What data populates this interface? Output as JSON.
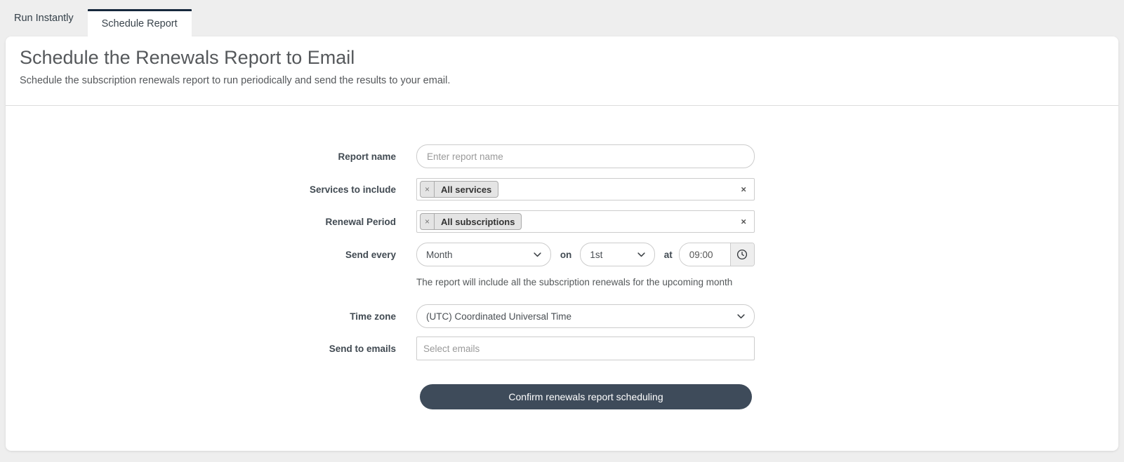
{
  "tabs": [
    {
      "label": "Run Instantly",
      "active": false
    },
    {
      "label": "Schedule Report",
      "active": true
    }
  ],
  "header": {
    "title": "Schedule the Renewals Report to Email",
    "subtitle": "Schedule the subscription renewals report to run periodically and send the results to your email."
  },
  "form": {
    "report_name": {
      "label": "Report name",
      "placeholder": "Enter report name",
      "value": ""
    },
    "services": {
      "label": "Services to include",
      "selected": [
        "All services"
      ]
    },
    "renewal_period": {
      "label": "Renewal Period",
      "selected": [
        "All subscriptions"
      ]
    },
    "send_every": {
      "label": "Send every",
      "frequency": "Month",
      "on_label": "on",
      "day": "1st",
      "at_label": "at",
      "time": "09:00"
    },
    "helper_text": "The report will include all the subscription renewals for the upcoming month",
    "time_zone": {
      "label": "Time zone",
      "value": "(UTC) Coordinated Universal Time"
    },
    "send_to_emails": {
      "label": "Send to emails",
      "placeholder": "Select emails"
    },
    "submit_label": "Confirm renewals report scheduling"
  },
  "icons": {
    "tag_remove": "×",
    "clear": "×"
  },
  "colors": {
    "page_background": "#eeeeee",
    "accent_tab_border": "#16283c",
    "button_background": "#3e4b5a",
    "tag_background": "#e4e4e4",
    "input_border": "#cccccc"
  }
}
